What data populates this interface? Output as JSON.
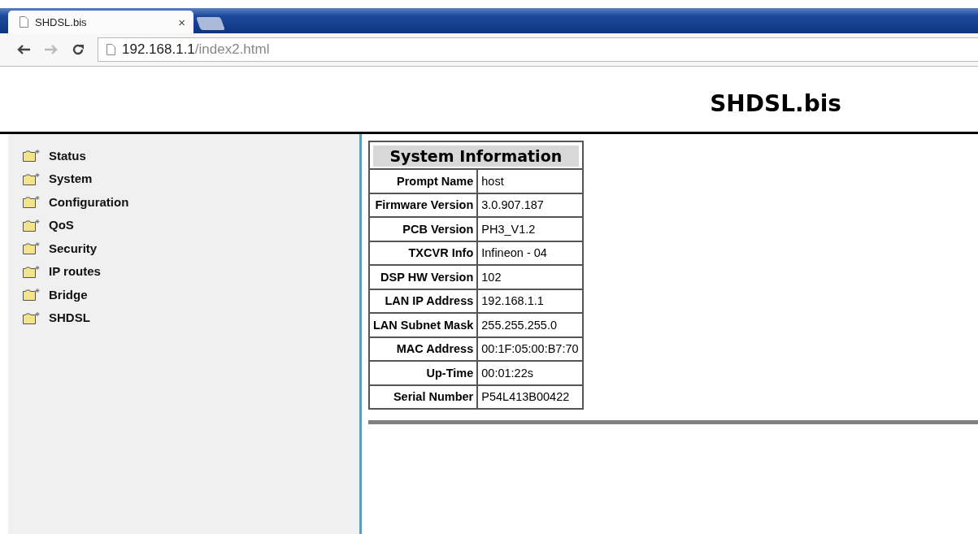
{
  "browser": {
    "tab_title": "SHDSL.bis",
    "tab_close": "×",
    "url_host": "192.168.1.1",
    "url_path": "/index2.html"
  },
  "header": {
    "title": "SHDSL.bis"
  },
  "sidebar": {
    "items": [
      {
        "label": "Status"
      },
      {
        "label": "System"
      },
      {
        "label": "Configuration"
      },
      {
        "label": "QoS"
      },
      {
        "label": "Security"
      },
      {
        "label": "IP routes"
      },
      {
        "label": "Bridge"
      },
      {
        "label": "SHDSL"
      }
    ]
  },
  "table": {
    "title": "System Information",
    "rows": [
      {
        "label": "Prompt Name",
        "value": "host"
      },
      {
        "label": "Firmware Version",
        "value": "3.0.907.187"
      },
      {
        "label": "PCB Version",
        "value": "PH3_V1.2"
      },
      {
        "label": "TXCVR Info",
        "value": "Infineon - 04"
      },
      {
        "label": "DSP HW Version",
        "value": "102"
      },
      {
        "label": "LAN IP Address",
        "value": "192.168.1.1"
      },
      {
        "label": "LAN Subnet Mask",
        "value": "255.255.255.0"
      },
      {
        "label": "MAC Address",
        "value": "00:1F:05:00:B7:70"
      },
      {
        "label": "Up-Time",
        "value": "00:01:22s"
      },
      {
        "label": "Serial Number",
        "value": "P54L413B00422"
      }
    ]
  }
}
